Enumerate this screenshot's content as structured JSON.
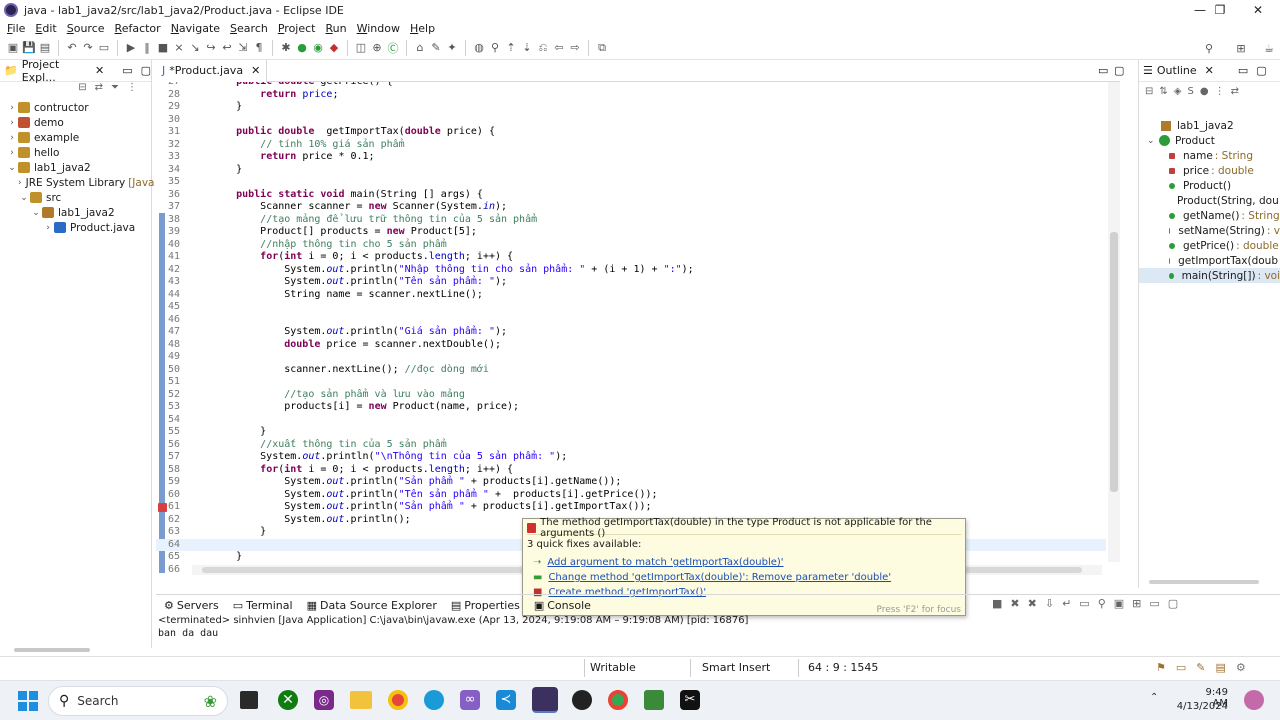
{
  "window": {
    "title": "java - lab1_java2/src/lab1_java2/Product.java - Eclipse IDE"
  },
  "menu": [
    "File",
    "Edit",
    "Source",
    "Refactor",
    "Navigate",
    "Search",
    "Project",
    "Run",
    "Window",
    "Help"
  ],
  "project_explorer": {
    "tab_label": "Project Expl...",
    "items": [
      {
        "label": "contructor",
        "indent": 0,
        "expanded": false
      },
      {
        "label": "demo",
        "indent": 0,
        "expanded": false
      },
      {
        "label": "example",
        "indent": 0,
        "expanded": false
      },
      {
        "label": "hello",
        "indent": 0,
        "expanded": false
      },
      {
        "label": "lab1_java2",
        "indent": 0,
        "expanded": true
      },
      {
        "label": "JRE System Library",
        "suffix": "[Java",
        "indent": 1,
        "expanded": false
      },
      {
        "label": "src",
        "indent": 1,
        "expanded": true
      },
      {
        "label": "lab1_java2",
        "indent": 2,
        "expanded": true
      },
      {
        "label": "Product.java",
        "indent": 3,
        "expanded": false
      }
    ]
  },
  "editor": {
    "tab_label": "*Product.java",
    "lines": [
      {
        "n": "27",
        "html": "    <span class=\"kw\">public double</span> getPrice() {"
      },
      {
        "n": "28",
        "html": "        <span class=\"kw\">return</span> <span class=\"fld\">price</span>;"
      },
      {
        "n": "29",
        "html": "    }"
      },
      {
        "n": "30",
        "html": ""
      },
      {
        "n": "31",
        "html": "    <span class=\"kw\">public double</span>  getImportTax(<span class=\"kw\">double</span> price) {"
      },
      {
        "n": "32",
        "html": "        <span class=\"cm\">// tính 10% giá sản phẩm</span>"
      },
      {
        "n": "33",
        "html": "        <span class=\"kw\">return</span> price * 0.1;"
      },
      {
        "n": "34",
        "html": "    }"
      },
      {
        "n": "35",
        "html": ""
      },
      {
        "n": "36",
        "html": "    <span class=\"kw\">public static void</span> main(String [] args) {"
      },
      {
        "n": "37",
        "html": "        Scanner scanner = <span class=\"kw\">new</span> Scanner(System.<span class=\"fld it\">in</span>);"
      },
      {
        "n": "38",
        "html": "        <span class=\"cm\">//tạo mảng để lưu trữ thông tin của 5 sản phẩm</span>"
      },
      {
        "n": "39",
        "html": "        Product[] products = <span class=\"kw\">new</span> Product[5];"
      },
      {
        "n": "40",
        "html": "        <span class=\"cm\">//nhập thông tin cho 5 sản phẩm</span>"
      },
      {
        "n": "41",
        "html": "        <span class=\"kw\">for</span>(<span class=\"kw\">int</span> i = 0; i &lt; products.<span class=\"fld\">length</span>; i++) {"
      },
      {
        "n": "42",
        "html": "            System.<span class=\"fld it\">out</span>.println(<span class=\"str\">\"Nhập thông tin cho sản phẩm: \"</span> + (i + 1) + <span class=\"str\">\":\"</span>);"
      },
      {
        "n": "43",
        "html": "            System.<span class=\"fld it\">out</span>.println(<span class=\"str\">\"Tên sản phẩm: \"</span>);"
      },
      {
        "n": "44",
        "html": "            String name = scanner.nextLine();"
      },
      {
        "n": "45",
        "html": ""
      },
      {
        "n": "46",
        "html": ""
      },
      {
        "n": "47",
        "html": "            System.<span class=\"fld it\">out</span>.println(<span class=\"str\">\"Giá sản phẩm: \"</span>);"
      },
      {
        "n": "48",
        "html": "            <span class=\"kw\">double</span> price = scanner.nextDouble();"
      },
      {
        "n": "49",
        "html": ""
      },
      {
        "n": "50",
        "html": "            scanner.nextLine(); <span class=\"cm\">//đọc dòng mới</span>"
      },
      {
        "n": "51",
        "html": ""
      },
      {
        "n": "52",
        "html": "            <span class=\"cm\">//tạo sản phẩm và lưu vào mảng</span>"
      },
      {
        "n": "53",
        "html": "            products[i] = <span class=\"kw\">new</span> Product(name, price);"
      },
      {
        "n": "54",
        "html": ""
      },
      {
        "n": "55",
        "html": "        }"
      },
      {
        "n": "56",
        "html": "        <span class=\"cm\">//xuất thông tin của 5 sản phẩm</span>"
      },
      {
        "n": "57",
        "html": "        System.<span class=\"fld it\">out</span>.println(<span class=\"str\">\"\\nThông tin của 5 sản phẩm: \"</span>);"
      },
      {
        "n": "58",
        "html": "        <span class=\"kw\">for</span>(<span class=\"kw\">int</span> i = 0; i &lt; products.<span class=\"fld\">length</span>; i++) {"
      },
      {
        "n": "59",
        "html": "            System.<span class=\"fld it\">out</span>.println(<span class=\"str\">\"Sản phẩm \"</span> + products[i].getName());"
      },
      {
        "n": "60",
        "html": "            System.<span class=\"fld it\">out</span>.println(<span class=\"str\">\"Tên sản phẩm \"</span> +  products[i].getPrice());"
      },
      {
        "n": "61",
        "html": "            System.<span class=\"fld it\">out</span>.println(<span class=\"str\">\"Sản phẩm \"</span> + products[i].getImportTax());"
      },
      {
        "n": "62",
        "html": "            System.<span class=\"fld it\">out</span>.println();"
      },
      {
        "n": "63",
        "html": "        }"
      },
      {
        "n": "64",
        "html": ""
      },
      {
        "n": "65",
        "html": "    }"
      },
      {
        "n": "66",
        "html": ""
      }
    ]
  },
  "outline": {
    "tab_label": "Outline",
    "items": [
      {
        "label": "lab1_java2",
        "type": ""
      },
      {
        "label": "Product",
        "type": ""
      },
      {
        "label": "name",
        "type": ": String"
      },
      {
        "label": "price",
        "type": ": double"
      },
      {
        "label": "Product()",
        "type": ""
      },
      {
        "label": "Product(String, dou",
        "type": ""
      },
      {
        "label": "getName()",
        "type": ": String"
      },
      {
        "label": "setName(String)",
        "type": ": v"
      },
      {
        "label": "getPrice()",
        "type": ": double"
      },
      {
        "label": "getImportTax(doub",
        "type": ""
      },
      {
        "label": "main(String[])",
        "type": ": voi"
      }
    ]
  },
  "popup": {
    "error": "The method getImportTax(double) in the type Product is not applicable for the arguments ()",
    "count": "3 quick fixes available:",
    "fixes": [
      "Add argument to match 'getImportTax(double)'",
      "Change method 'getImportTax(double)': Remove parameter 'double'",
      "Create method 'getImportTax()'"
    ],
    "footer": "Press 'F2' for focus"
  },
  "bottom": {
    "tabs": [
      "Servers",
      "Terminal",
      "Data Source Explorer",
      "Properties",
      "Console"
    ],
    "terminated": "<terminated> sinhvien [Java Application] C:\\java\\bin\\javaw.exe  (Apr 13, 2024, 9:19:08 AM – 9:19:08 AM) [pid: 16876]",
    "output": "ban da dau"
  },
  "status": {
    "mode": "Writable",
    "insert": "Smart Insert",
    "position": "64 : 9 : 1545"
  },
  "taskbar": {
    "search": "Search",
    "time": "9:49 AM",
    "date": "4/13/2024"
  },
  "colors": {
    "accent": "#7a9bd0",
    "popup_bg": "#fdfbe0",
    "keyword": "#7f0055",
    "comment": "#3f7f5f",
    "string": "#2a00ff"
  }
}
